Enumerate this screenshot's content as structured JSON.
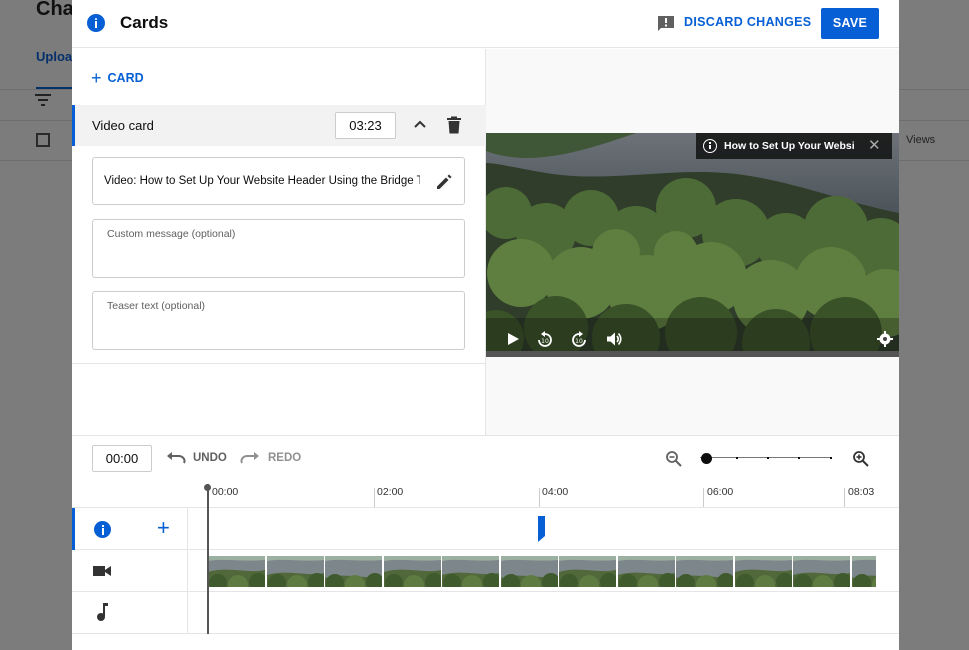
{
  "background": {
    "title": "Cha",
    "tab_label": "Uploa",
    "views_header": "Views"
  },
  "dialog": {
    "title": "Cards",
    "discard_label": "DISCARD CHANGES",
    "save_label": "SAVE"
  },
  "cards_panel": {
    "add_card_label": "CARD",
    "card": {
      "type_label": "Video card",
      "time": "03:23",
      "video_field": "Video: How to Set Up Your Website Header Using the Bridge Theme",
      "custom_message_placeholder": "Custom message (optional)",
      "teaser_text_placeholder": "Teaser text (optional)"
    }
  },
  "preview": {
    "card_teaser_text": "How to Set Up Your Website Header"
  },
  "timeline": {
    "current_time": "00:00",
    "undo_label": "UNDO",
    "redo_label": "REDO",
    "ruler_labels": [
      "00:00",
      "02:00",
      "04:00",
      "06:00",
      "08:03"
    ],
    "card_marker_time": "03:23",
    "zoom_level_fraction": 0
  },
  "colors": {
    "accent": "#065fd4",
    "text": "#0d0d0d",
    "muted": "#606060"
  },
  "icons": {
    "dialog_icon": "info-icon",
    "feedback": "feedback-icon",
    "add": "plus-icon",
    "collapse": "chevron-up-icon",
    "delete": "trash-icon",
    "edit": "pencil-icon",
    "play": "play-icon",
    "rewind": "replay-10-icon",
    "forward": "forward-10-icon",
    "volume": "volume-icon",
    "settings": "gear-icon",
    "undo": "undo-icon",
    "redo": "redo-icon",
    "zoom_out": "zoom-out-icon",
    "zoom_in": "zoom-in-icon",
    "video_track": "videocam-icon",
    "audio_track": "music-note-icon"
  }
}
